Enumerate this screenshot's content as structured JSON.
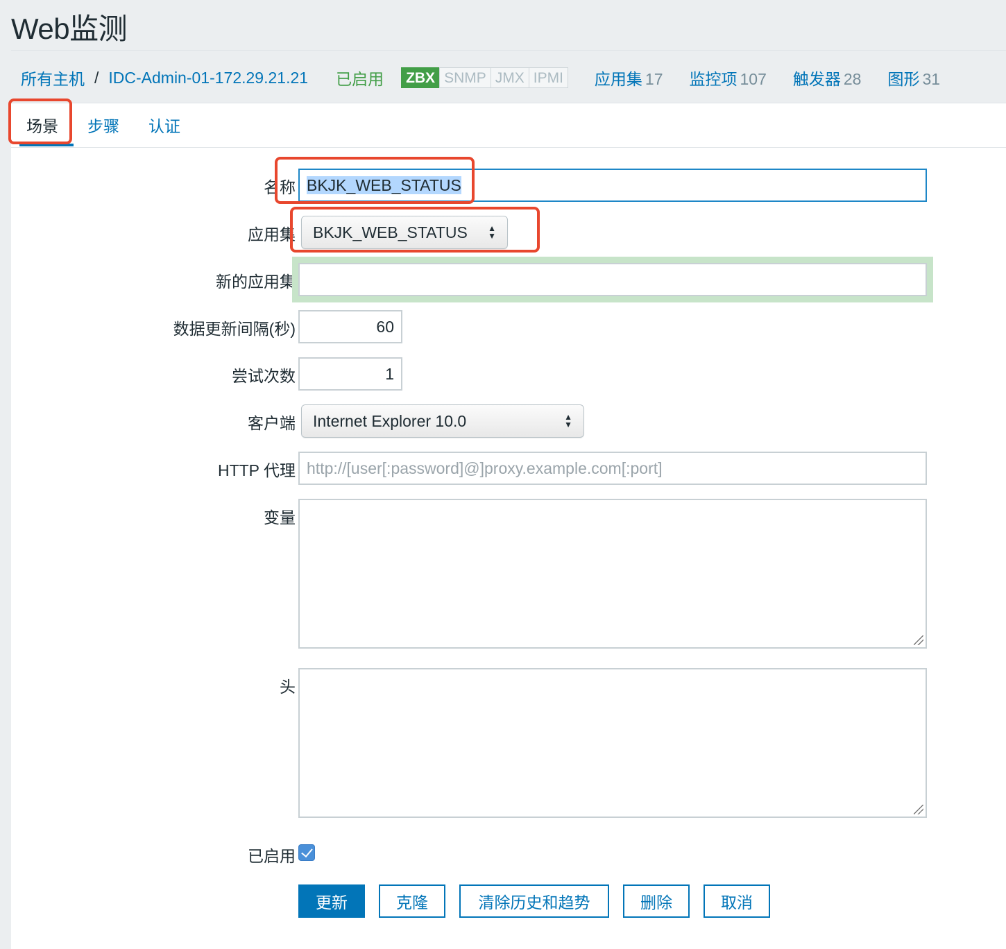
{
  "page": {
    "title": "Web监测"
  },
  "host_nav": {
    "all_hosts": "所有主机",
    "separator": "/",
    "host": "IDC-Admin-01-172.29.21.21",
    "status": "已启用",
    "badges": [
      "ZBX",
      "SNMP",
      "JMX",
      "IPMI"
    ],
    "items": [
      {
        "label": "应用集",
        "count": "17"
      },
      {
        "label": "监控项",
        "count": "107"
      },
      {
        "label": "触发器",
        "count": "28"
      },
      {
        "label": "图形",
        "count": "31"
      }
    ]
  },
  "tabs": [
    "场景",
    "步骤",
    "认证"
  ],
  "form": {
    "name": {
      "label": "名称",
      "value": "BKJK_WEB_STATUS"
    },
    "application": {
      "label": "应用集",
      "value": "BKJK_WEB_STATUS"
    },
    "new_application": {
      "label": "新的应用集",
      "value": ""
    },
    "interval": {
      "label": "数据更新间隔(秒)",
      "value": "60"
    },
    "attempts": {
      "label": "尝试次数",
      "value": "1"
    },
    "agent": {
      "label": "客户端",
      "value": "Internet Explorer 10.0"
    },
    "http_proxy": {
      "label": "HTTP 代理",
      "placeholder": "http://[user[:password]@]proxy.example.com[:port]"
    },
    "variables": {
      "label": "变量"
    },
    "headers": {
      "label": "头"
    },
    "enabled": {
      "label": "已启用",
      "checked": true
    }
  },
  "buttons": {
    "update": "更新",
    "clone": "克隆",
    "clear_history": "清除历史和趋势",
    "delete": "删除",
    "cancel": "取消"
  },
  "colors": {
    "link": "#0275b8",
    "enabled": "#429e47",
    "highlight": "#e8472e"
  }
}
